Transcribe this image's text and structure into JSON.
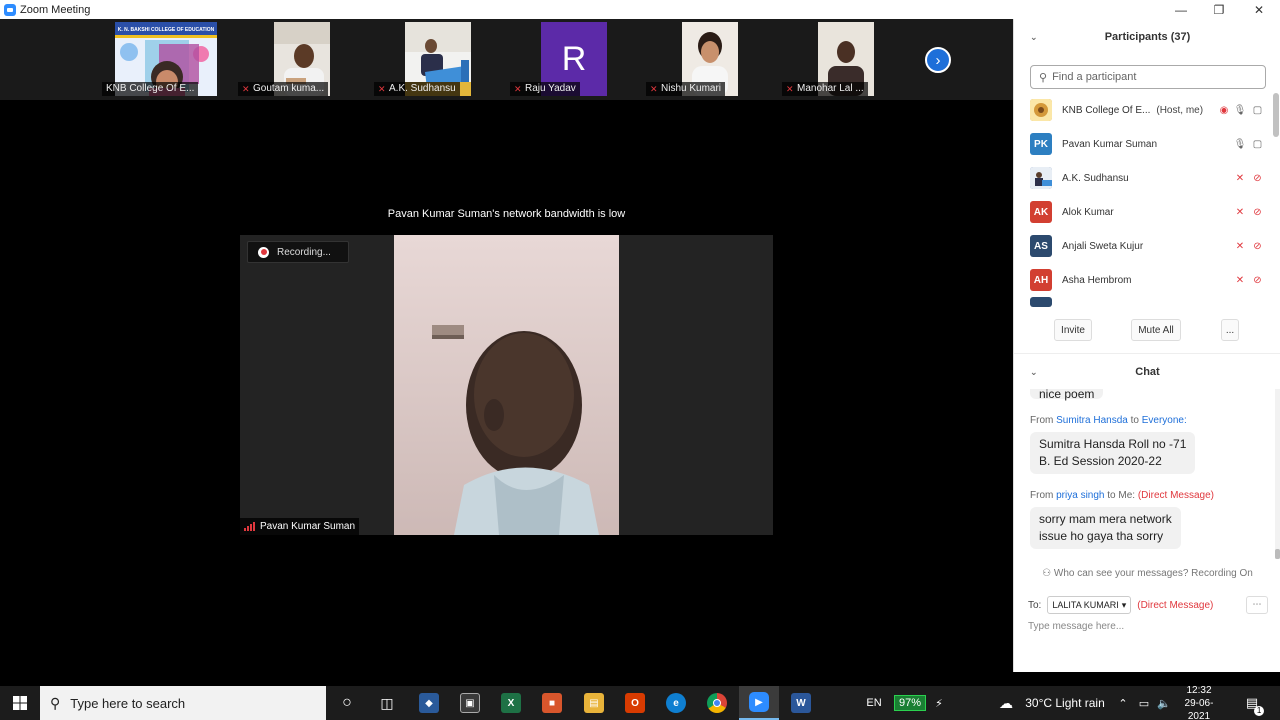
{
  "window": {
    "title": "Zoom Meeting"
  },
  "thumbnails": [
    {
      "name": "KNB College Of E...",
      "muted": false
    },
    {
      "name": "Goutam kuma...",
      "muted": true
    },
    {
      "name": "A.K. Sudhansu",
      "muted": true
    },
    {
      "name": "Raju Yadav",
      "muted": true,
      "avatar_letter": "R"
    },
    {
      "name": "Nishu Kumari",
      "muted": true
    },
    {
      "name": "Manohar Lal ...",
      "muted": true
    }
  ],
  "banner_text": {
    "title": "K. N. BAKSHI COLLEGE OF EDUCATION"
  },
  "stage": {
    "bandwidth_note": "Pavan Kumar Suman's network bandwidth is low",
    "recording_label": "Recording...",
    "speaker_name": "Pavan Kumar Suman"
  },
  "participants": {
    "header": "Participants (37)",
    "search_placeholder": "Find a participant",
    "list": [
      {
        "initials": "",
        "name": "KNB College Of E...",
        "tag": "(Host, me)",
        "color": "#c9a24a",
        "state": "host"
      },
      {
        "initials": "PK",
        "name": "Pavan Kumar Suman",
        "tag": "",
        "color": "#2d7fc1",
        "state": "active"
      },
      {
        "initials": "",
        "name": "A.K. Sudhansu",
        "tag": "",
        "color": "#4a6fa5",
        "state": "muted"
      },
      {
        "initials": "AK",
        "name": "Alok Kumar",
        "tag": "",
        "color": "#d23f31",
        "state": "muted"
      },
      {
        "initials": "AS",
        "name": "Anjali Sweta Kujur",
        "tag": "",
        "color": "#2c4a6e",
        "state": "muted"
      },
      {
        "initials": "AH",
        "name": "Asha Hembrom",
        "tag": "",
        "color": "#d23f31",
        "state": "muted"
      }
    ],
    "invite_label": "Invite",
    "mute_all_label": "Mute All",
    "more_label": "..."
  },
  "chat": {
    "header": "Chat",
    "partial_text": "nice poem",
    "messages": [
      {
        "from_label": "From",
        "sender": "Sumitra Hansda",
        "to_label": "to",
        "recipient": "Everyone:",
        "direct": "",
        "line1": "Sumitra Hansda Roll no -71",
        "line2": "B. Ed Session 2020-22"
      },
      {
        "from_label": "From",
        "sender": "priya singh",
        "to_label": "to Me:",
        "recipient": "",
        "direct": "(Direct Message)",
        "line1": "sorry mam mera network",
        "line2": "issue ho gaya  tha sorry"
      }
    ],
    "visibility_note": "Who can see your messages? Recording On",
    "to_label": "To:",
    "to_value": "LALITA KUMARI",
    "to_direct": "(Direct Message)",
    "input_placeholder": "Type message here..."
  },
  "taskbar": {
    "search_placeholder": "Type here to search",
    "language": "EN",
    "battery": "97%",
    "weather": "30°C  Light rain",
    "time": "12:32",
    "date": "29-06-2021",
    "notification_count": "1"
  }
}
